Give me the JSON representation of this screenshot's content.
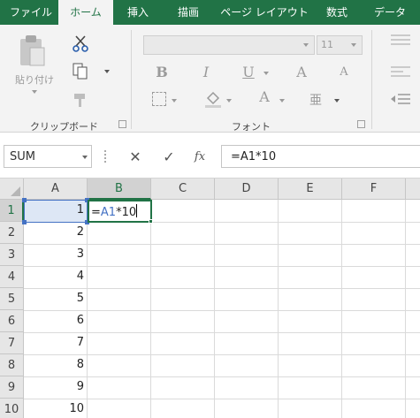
{
  "ribbon_tabs": [
    "ファイル",
    "ホーム",
    "挿入",
    "描画",
    "ページ レイアウト",
    "数式",
    "データ"
  ],
  "clipboard": {
    "paste_label_line1": "貼り付け",
    "group_label": "クリップボード"
  },
  "font": {
    "group_label": "フォント",
    "font_size": "11",
    "bold_glyph": "B",
    "italic_glyph": "I",
    "underline_glyph": "U",
    "grow_glyph": "A",
    "shrink_glyph": "A",
    "color_glyph": "A"
  },
  "formula_bar": {
    "name_box": "SUM",
    "cancel_glyph": "✕",
    "enter_glyph": "✓",
    "fx_glyph": "fx",
    "formula": "=A1*10"
  },
  "grid": {
    "columns": [
      "A",
      "B",
      "C",
      "D",
      "E",
      "F"
    ],
    "rows": [
      "1",
      "2",
      "3",
      "4",
      "5",
      "6",
      "7",
      "8",
      "9",
      "10"
    ],
    "column_a_values": [
      "1",
      "2",
      "3",
      "4",
      "5",
      "6",
      "7",
      "8",
      "9",
      "10"
    ],
    "editing_cell": {
      "prefix": "=",
      "ref": "A1",
      "suffix": "*10"
    }
  },
  "colors": {
    "accent": "#217346",
    "reference": "#4472c4"
  }
}
